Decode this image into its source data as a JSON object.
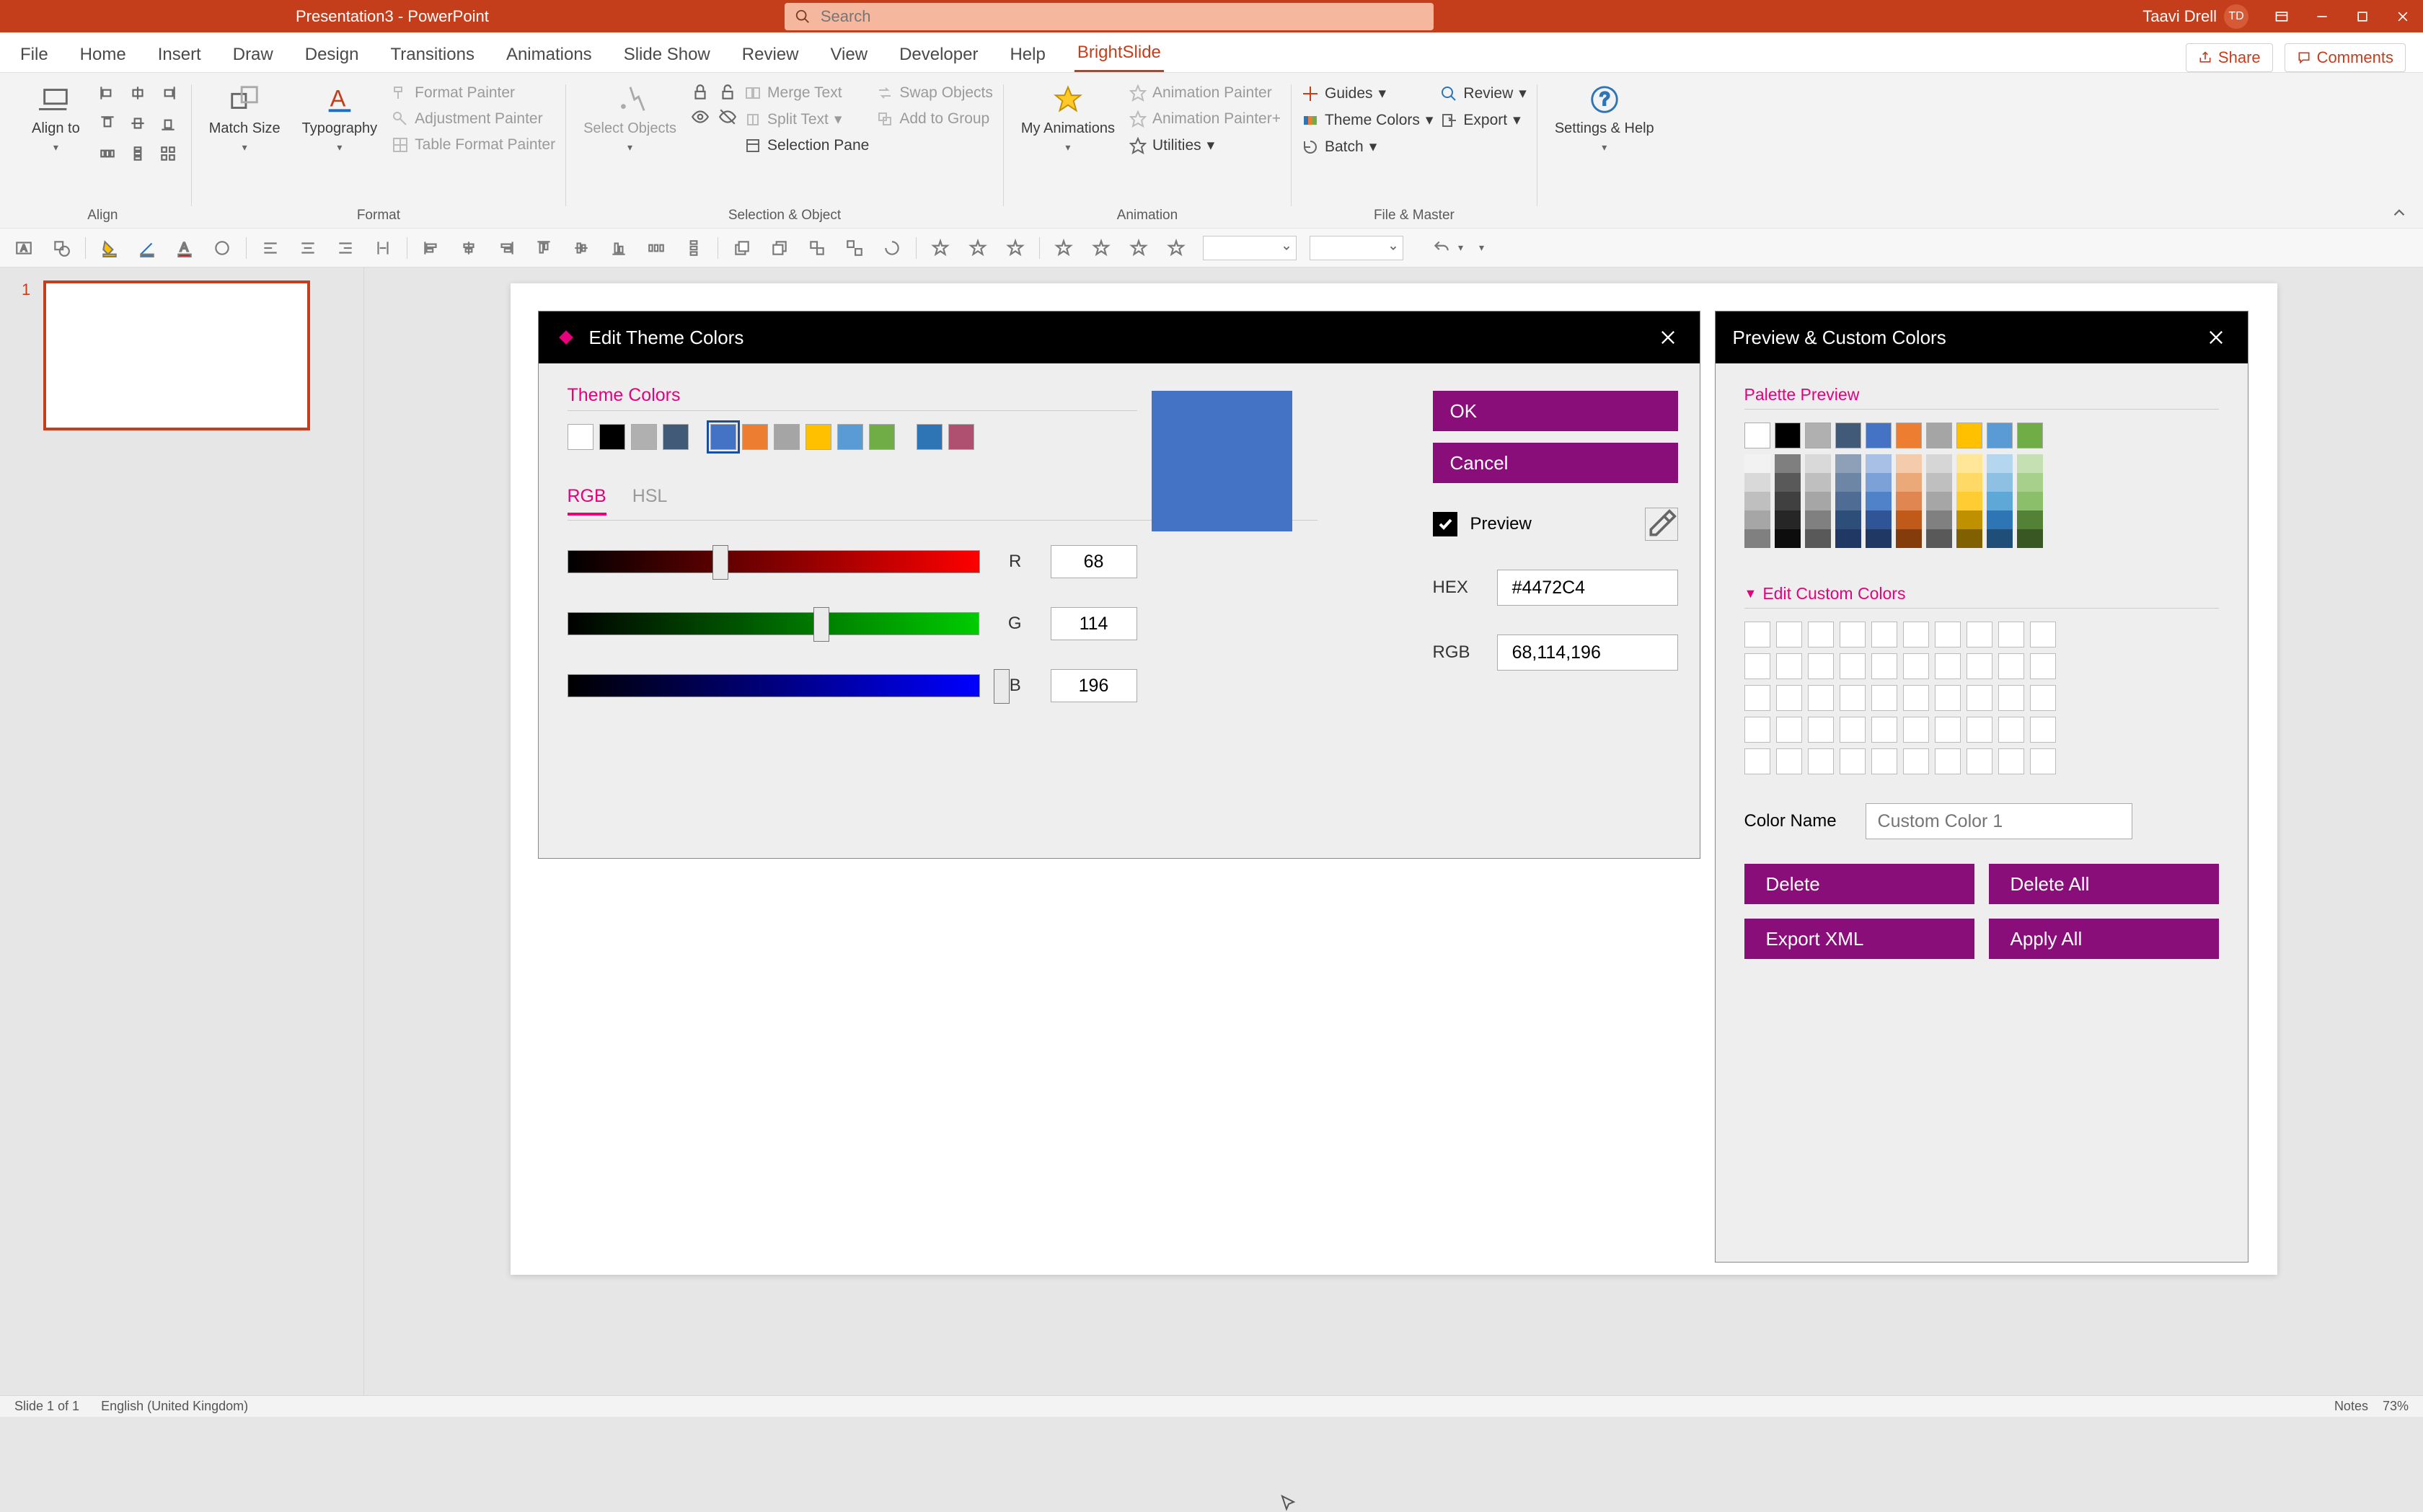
{
  "window": {
    "title": "Presentation3  -  PowerPoint",
    "user_name": "Taavi Drell",
    "user_initials": "TD"
  },
  "search": {
    "placeholder": "Search"
  },
  "tabs": {
    "file": "File",
    "home": "Home",
    "insert": "Insert",
    "draw": "Draw",
    "design": "Design",
    "transitions": "Transitions",
    "animations": "Animations",
    "slideshow": "Slide Show",
    "review": "Review",
    "view": "View",
    "developer": "Developer",
    "help": "Help",
    "brightslide": "BrightSlide",
    "share": "Share",
    "comments": "Comments"
  },
  "ribbon": {
    "align_to": "Align to",
    "match_size": "Match Size",
    "typography": "Typography",
    "format_painter": "Format Painter",
    "adjustment_painter": "Adjustment Painter",
    "table_format_painter": "Table Format Painter",
    "select_objects": "Select Objects",
    "merge_text": "Merge Text",
    "swap_objects": "Swap Objects",
    "split_text": "Split Text",
    "add_to_group": "Add to Group",
    "selection_pane": "Selection Pane",
    "my_animations": "My Animations",
    "animation_painter": "Animation Painter",
    "animation_painter_plus": "Animation Painter+",
    "utilities": "Utilities",
    "guides": "Guides",
    "theme_colors": "Theme Colors",
    "batch": "Batch",
    "review": "Review",
    "export": "Export",
    "settings_help": "Settings & Help",
    "group_align": "Align",
    "group_format": "Format",
    "group_selobj": "Selection & Object",
    "group_anim": "Animation",
    "group_file": "File & Master"
  },
  "thumb": {
    "num": "1"
  },
  "dlg1": {
    "title": "Edit Theme Colors",
    "theme_colors_label": "Theme Colors",
    "rgb": "RGB",
    "hsl": "HSL",
    "r": "R",
    "g": "G",
    "b": "B",
    "r_val": "68",
    "g_val": "114",
    "b_val": "196",
    "ok": "OK",
    "cancel": "Cancel",
    "preview": "Preview",
    "hex_label": "HEX",
    "hex_val": "#4472C4",
    "rgb_label": "RGB",
    "rgb_val": "68,114,196",
    "swatches": [
      "#ffffff",
      "#000000",
      "#b0b0b0",
      "#405a78",
      "",
      "#4472C4",
      "#ed7d31",
      "#a5a5a5",
      "#ffc000",
      "#5b9bd5",
      "#70ad47",
      "",
      "#2e75b6",
      "#b05070"
    ]
  },
  "dlg2": {
    "title": "Preview & Custom Colors",
    "palette_preview": "Palette Preview",
    "edit_custom": "Edit Custom Colors",
    "color_name_label": "Color Name",
    "color_name_placeholder": "Custom Color 1",
    "delete": "Delete",
    "delete_all": "Delete All",
    "export_xml": "Export XML",
    "apply_all": "Apply All",
    "palette_base": [
      "#ffffff",
      "#000000",
      "#b0b0b0",
      "#405a78",
      "#4472C4",
      "#ed7d31",
      "#a5a5a5",
      "#ffc000",
      "#5b9bd5",
      "#70ad47"
    ],
    "palette_shades": [
      [
        "#f2f2f2",
        "#7f7f7f",
        "#d9d9d9",
        "#8ea0b8",
        "#a9c0e6",
        "#f4cbac",
        "#d6d6d6",
        "#ffe699",
        "#b4d6ee",
        "#c5e0b3"
      ],
      [
        "#d9d9d9",
        "#595959",
        "#bfbfbf",
        "#6e86a6",
        "#7ca0d8",
        "#eba97a",
        "#bfbfbf",
        "#ffd966",
        "#8ec0e4",
        "#a8d08d"
      ],
      [
        "#bfbfbf",
        "#404040",
        "#a6a6a6",
        "#4f6c94",
        "#4f82c8",
        "#e08650",
        "#a6a6a6",
        "#ffcc33",
        "#5ea8d8",
        "#8bbf6a"
      ],
      [
        "#a6a6a6",
        "#262626",
        "#808080",
        "#2e4e7a",
        "#2f5597",
        "#c05a1a",
        "#808080",
        "#bf9000",
        "#2e75b6",
        "#538135"
      ],
      [
        "#808080",
        "#0d0d0d",
        "#595959",
        "#1f3864",
        "#1f3864",
        "#843c0c",
        "#595959",
        "#806000",
        "#1f4e79",
        "#385723"
      ]
    ]
  },
  "status": {
    "slide": "Slide 1 of 1",
    "lang": "English (United Kingdom)",
    "notes": "Notes",
    "zoom": "73%"
  }
}
